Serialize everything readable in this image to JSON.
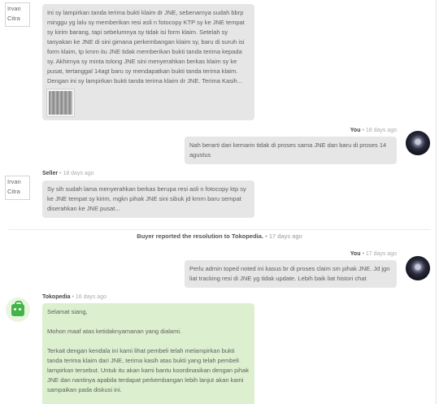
{
  "messages": [
    {
      "sender": "Irvan Citra",
      "text": "Ini sy lampirkan tanda terima bukti klaim dr JNE, sebenarnya sudah bbrp minggu yg lalu sy memberikan resi asli n fotocopy KTP sy ke JNE tempat sy kirim barang, tapi sebelumnya sy tidak isi form klaim. Setelah sy tanyakan ke JNE di sini gimana perkembangan klaim sy, baru di suruh isi form klaim, tp kmrn itu JNE tidak memberikan bukti tanda terima kepada sy. Akhirnya sy minta tolong JNE sini menyerahkan berkas klaim sy ke pusat, tertanggal 14agt baru sy mendapatkan bukti tanda terima klaim. Dengan ini sy lampirkan bukti tanda terima klaim dr JNE. Terima Kasih..."
    },
    {
      "sender": "You",
      "time": "18 days ago",
      "text": "Nah berarti dari kemarin tidak di proses sama JNE dan baru di proses 14 agustus"
    },
    {
      "sender": "Seller",
      "time": "18 days ago",
      "avatar_label": "Irvan Citra",
      "text": "Sy sih sudah lama menyerahkan berkas berupa resi asli n fotocopy ktp sy ke JNE tempat sy kirim, mgkn pihak JNE sini sibuk jd kmrn baru sempat diserahkan ke JNE pusat..."
    },
    {
      "sender": "You",
      "time": "17 days ago",
      "text": "Perlu admin toped noted ini kasus br di proses claim sm pihak JNE. Jd jgn liat tracking resi di JNE yg tidak update. Lebih baik liat histori chat"
    },
    {
      "sender": "Tokopedia",
      "time": "16 days ago",
      "paragraphs": [
        "Selamat siang,",
        "Mohon maaf atas ketidaknyamanan yang dialami.",
        "Terkait dengan kendala ini kami lihat pembeli telah melampirkan bukti tanda terima klaim dari JNE, terima kasih atas bukti yang telah pembeli lampirkan tersebut. Untuk itu akan kami bantu koordinasikan dengan pihak JNE dan nantinya apabila terdapat perkembangan lebih lanjut akan kami sampaikan pada diskusi ini."
      ]
    }
  ],
  "system": {
    "text": "Buyer reported the resolution to Tokopedia.",
    "time": "17 days ago"
  },
  "separator": "•",
  "colors": {
    "bubble_grey": "#e6e6e6",
    "bubble_green": "#dcf0cf",
    "tokopedia_green": "#42b549"
  },
  "icons": [
    "user-avatar-icon",
    "tokopedia-logo-icon",
    "attachment-thumbnail"
  ]
}
